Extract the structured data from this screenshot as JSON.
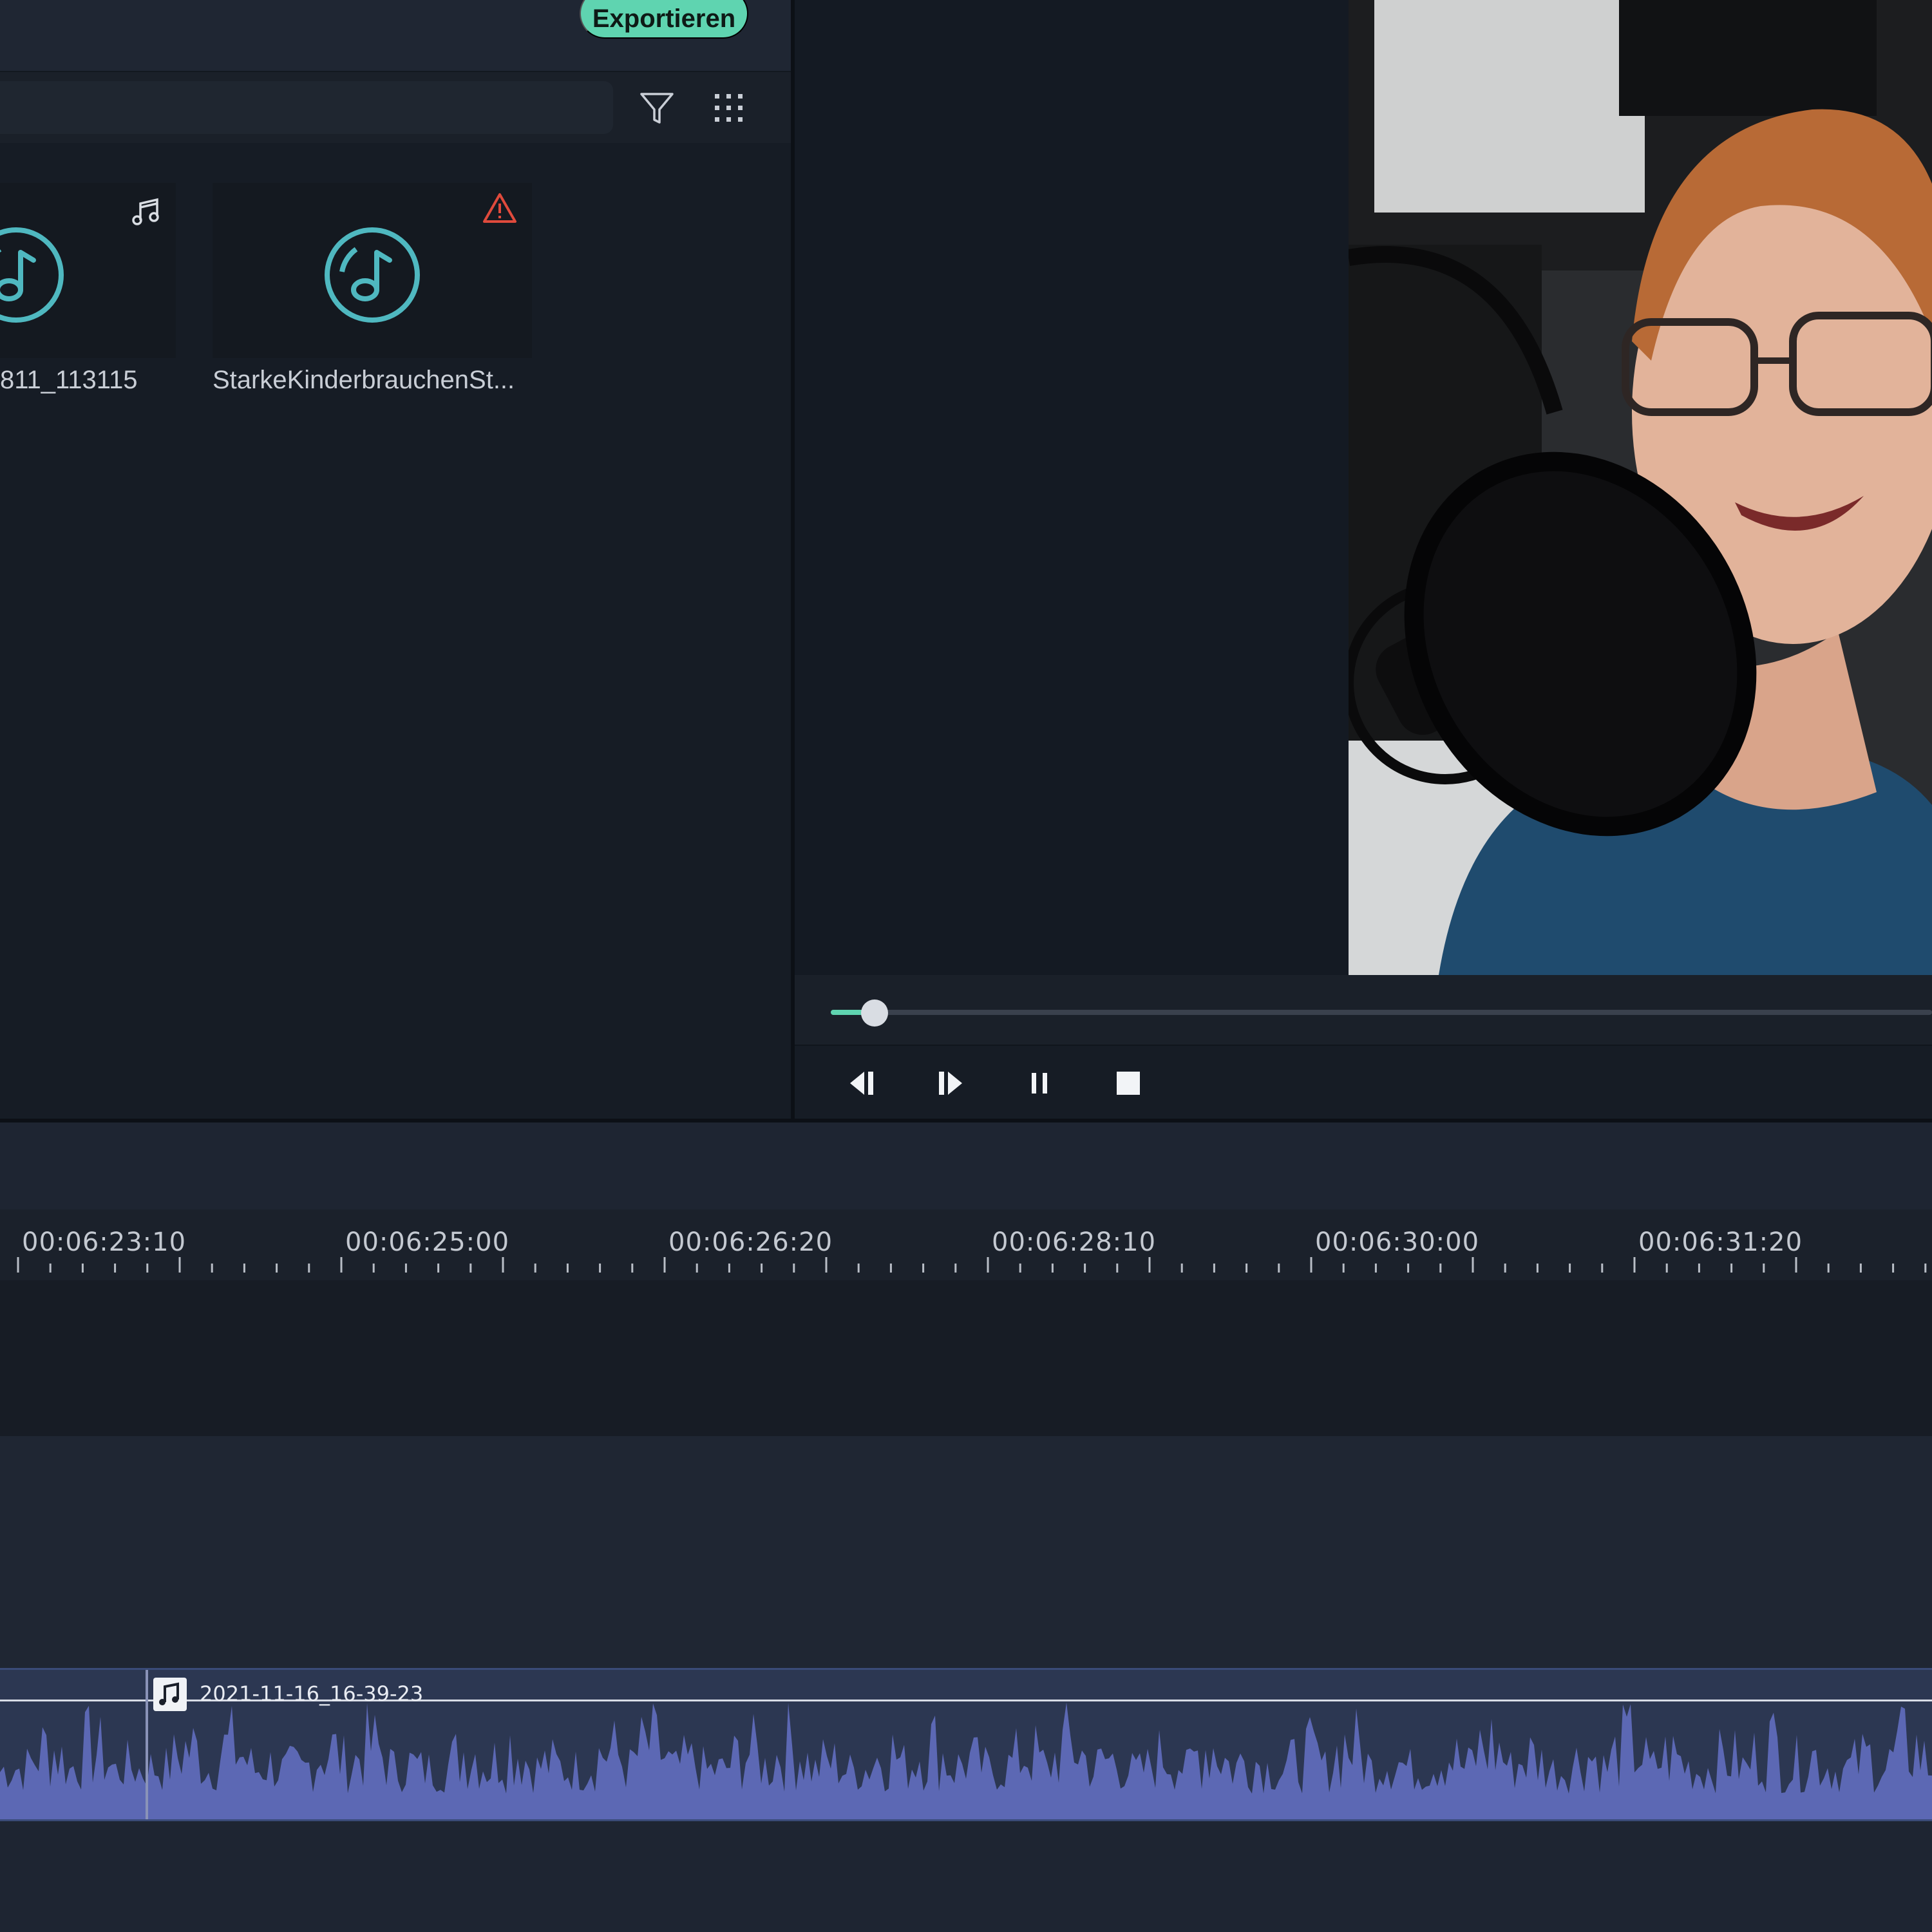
{
  "header": {
    "export_label": "Exportieren"
  },
  "media_library": {
    "items": [
      {
        "name": "811_113115",
        "type": "audio",
        "badge_icon": "music-notes-icon"
      },
      {
        "name": "StarkeKinderbrauchenSt...",
        "type": "audio",
        "badge_icon": "warning-icon"
      }
    ]
  },
  "player": {
    "progress": 0.04,
    "controls": [
      "step-back-icon",
      "step-forward-icon",
      "pause-icon",
      "stop-icon"
    ]
  },
  "timeline": {
    "ruler_labels": [
      "00:06:23:10",
      "00:06:25:00",
      "00:06:26:20",
      "00:06:28:10",
      "00:06:30:00",
      "00:06:31:20"
    ],
    "audio_clip": {
      "label": "2021-11-16_16-39-23"
    }
  },
  "colors": {
    "accent": "#5fd4b0",
    "warning": "#e04a3c",
    "waveform": "#5c68b4",
    "clip_bg": "#2c3752"
  }
}
